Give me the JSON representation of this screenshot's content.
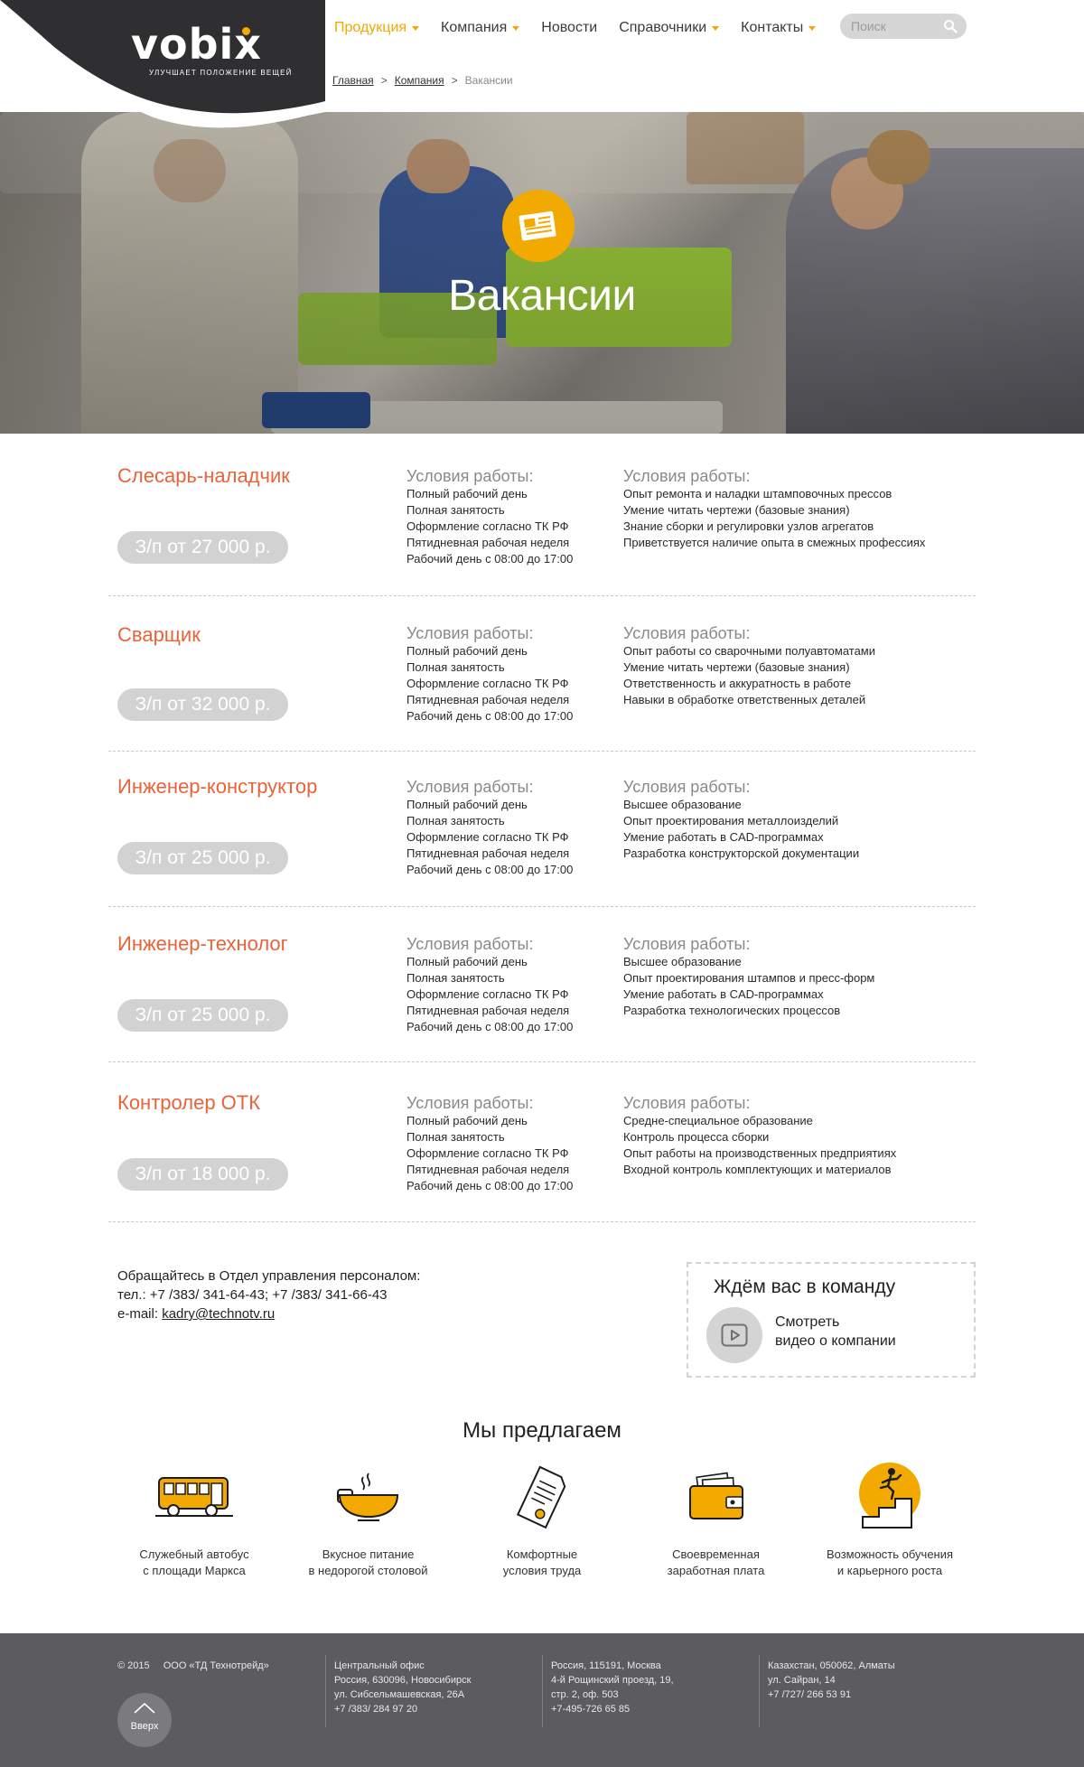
{
  "header": {
    "logo_text": "vobix",
    "logo_tagline": "улучшает положение вещей",
    "nav": [
      {
        "label": "Продукция",
        "dropdown": true,
        "active": true
      },
      {
        "label": "Компания",
        "dropdown": true,
        "active": false
      },
      {
        "label": "Новости",
        "dropdown": false,
        "active": false
      },
      {
        "label": "Справочники",
        "dropdown": true,
        "active": false
      },
      {
        "label": "Контакты",
        "dropdown": true,
        "active": false
      }
    ],
    "search": {
      "placeholder": "Поиск",
      "icon": "search-icon"
    }
  },
  "breadcrumb": {
    "items": [
      "Главная",
      "Компания"
    ],
    "separator": ">",
    "current": "Вакансии"
  },
  "hero": {
    "title": "Вакансии",
    "badge_icon": "newspaper-icon"
  },
  "conditions_heading": "Условия работы:",
  "vacancies": [
    {
      "title": "Слесарь-наладчик",
      "salary": "З/п от 27 000 р.",
      "conditions": [
        "Полный рабочий день",
        "Полная занятость",
        "Оформление согласно ТК РФ",
        "Пятидневная рабочая неделя",
        "Рабочий день с 08:00 до 17:00"
      ],
      "requirements": [
        "Опыт ремонта и наладки штамповочных прессов",
        "Умение читать чертежи (базовые знания)",
        "Знание сборки и регулировки узлов агрегатов",
        "Приветствуется наличие опыта в смежных профессиях"
      ]
    },
    {
      "title": "Сварщик",
      "salary": "З/п от 32 000 р.",
      "conditions": [
        "Полный рабочий день",
        "Полная занятость",
        "Оформление согласно ТК РФ",
        "Пятидневная рабочая неделя",
        "Рабочий день с 08:00 до 17:00"
      ],
      "requirements": [
        "Опыт работы со сварочными полуавтоматами",
        "Умение читать чертежи (базовые знания)",
        "Ответственность и аккуратность в работе",
        "Навыки в обработке ответственных деталей"
      ]
    },
    {
      "title": "Инженер-конструктор",
      "salary": "З/п от 25 000 р.",
      "conditions": [
        "Полный рабочий день",
        "Полная занятость",
        "Оформление согласно ТК РФ",
        "Пятидневная рабочая неделя",
        "Рабочий день с 08:00 до 17:00"
      ],
      "requirements": [
        "Высшее образование",
        "Опыт проектирования металлоизделий",
        "Умение работать в CAD-программах",
        "Разработка конструкторской документации"
      ]
    },
    {
      "title": "Инженер-технолог",
      "salary": "З/п от 25 000 р.",
      "conditions": [
        "Полный рабочий день",
        "Полная занятость",
        "Оформление согласно ТК РФ",
        "Пятидневная рабочая неделя",
        "Рабочий день с 08:00 до 17:00"
      ],
      "requirements": [
        "Высшее образование",
        "Опыт проектирования штампов и пресс-форм",
        "Умение работать в CAD-программах",
        "Разработка технологических процессов"
      ]
    },
    {
      "title": "Контролер ОТК",
      "salary": "З/п от 18 000 р.",
      "conditions": [
        "Полный рабочий день",
        "Полная занятость",
        "Оформление согласно ТК РФ",
        "Пятидневная рабочая неделя",
        "Рабочий день с 08:00 до 17:00"
      ],
      "requirements": [
        "Средне-специальное образование",
        "Контроль процесса сборки",
        "Опыт работы на производственных предприятиях",
        "Входной контроль комплектующих и материалов"
      ]
    }
  ],
  "contact": {
    "line1": "Обращайтесь в Отдел управления персоналом:",
    "phones": "тел.: +7 /383/ 341-64-43; +7 /383/ 341-66-43",
    "email_label": "e-mail:",
    "email": "kadry@technotv.ru"
  },
  "team_box": {
    "title": "Ждём вас в команду",
    "link_line1": "Смотреть",
    "link_line2": "видео о компании",
    "icon": "play-icon"
  },
  "offers": {
    "title": "Мы предлагаем",
    "items": [
      {
        "icon": "bus-icon",
        "line1": "Служебный автобус",
        "line2": "с площади Маркса"
      },
      {
        "icon": "food-bowl-icon",
        "line1": "Вкусное питание",
        "line2": "в недорогой столовой"
      },
      {
        "icon": "document-icon",
        "line1": "Комфортные",
        "line2": "условия труда"
      },
      {
        "icon": "wallet-icon",
        "line1": "Своевременная",
        "line2": "заработная плата"
      },
      {
        "icon": "career-stairs-icon",
        "line1": "Возможность обучения",
        "line2": "и карьерного роста"
      }
    ]
  },
  "footer": {
    "copyright": "© 2015",
    "company": "ООО «ТД Технотрейд»",
    "up_label": "Вверх",
    "offices": [
      [
        "Центральный офис",
        "Россия, 630096, Новосибирск",
        "ул. Сибсельмашевская, 26А",
        "+7 /383/ 284 97 20"
      ],
      [
        "Россия, 115191, Москва",
        "4-й Рощинский проезд, 19,",
        "стр. 2, оф. 503",
        "+7-495-726 65 85"
      ],
      [
        "Казахстан, 050062, Алматы",
        "ул. Сайран, 14",
        "+7 /727/ 266 53 91"
      ]
    ]
  },
  "colors": {
    "accent": "#f2a900",
    "vacancy_title": "#e8633a",
    "header_dark": "#2f2f31",
    "footer_bg": "#5c5c60",
    "salary_pill": "#d2d2d2"
  }
}
